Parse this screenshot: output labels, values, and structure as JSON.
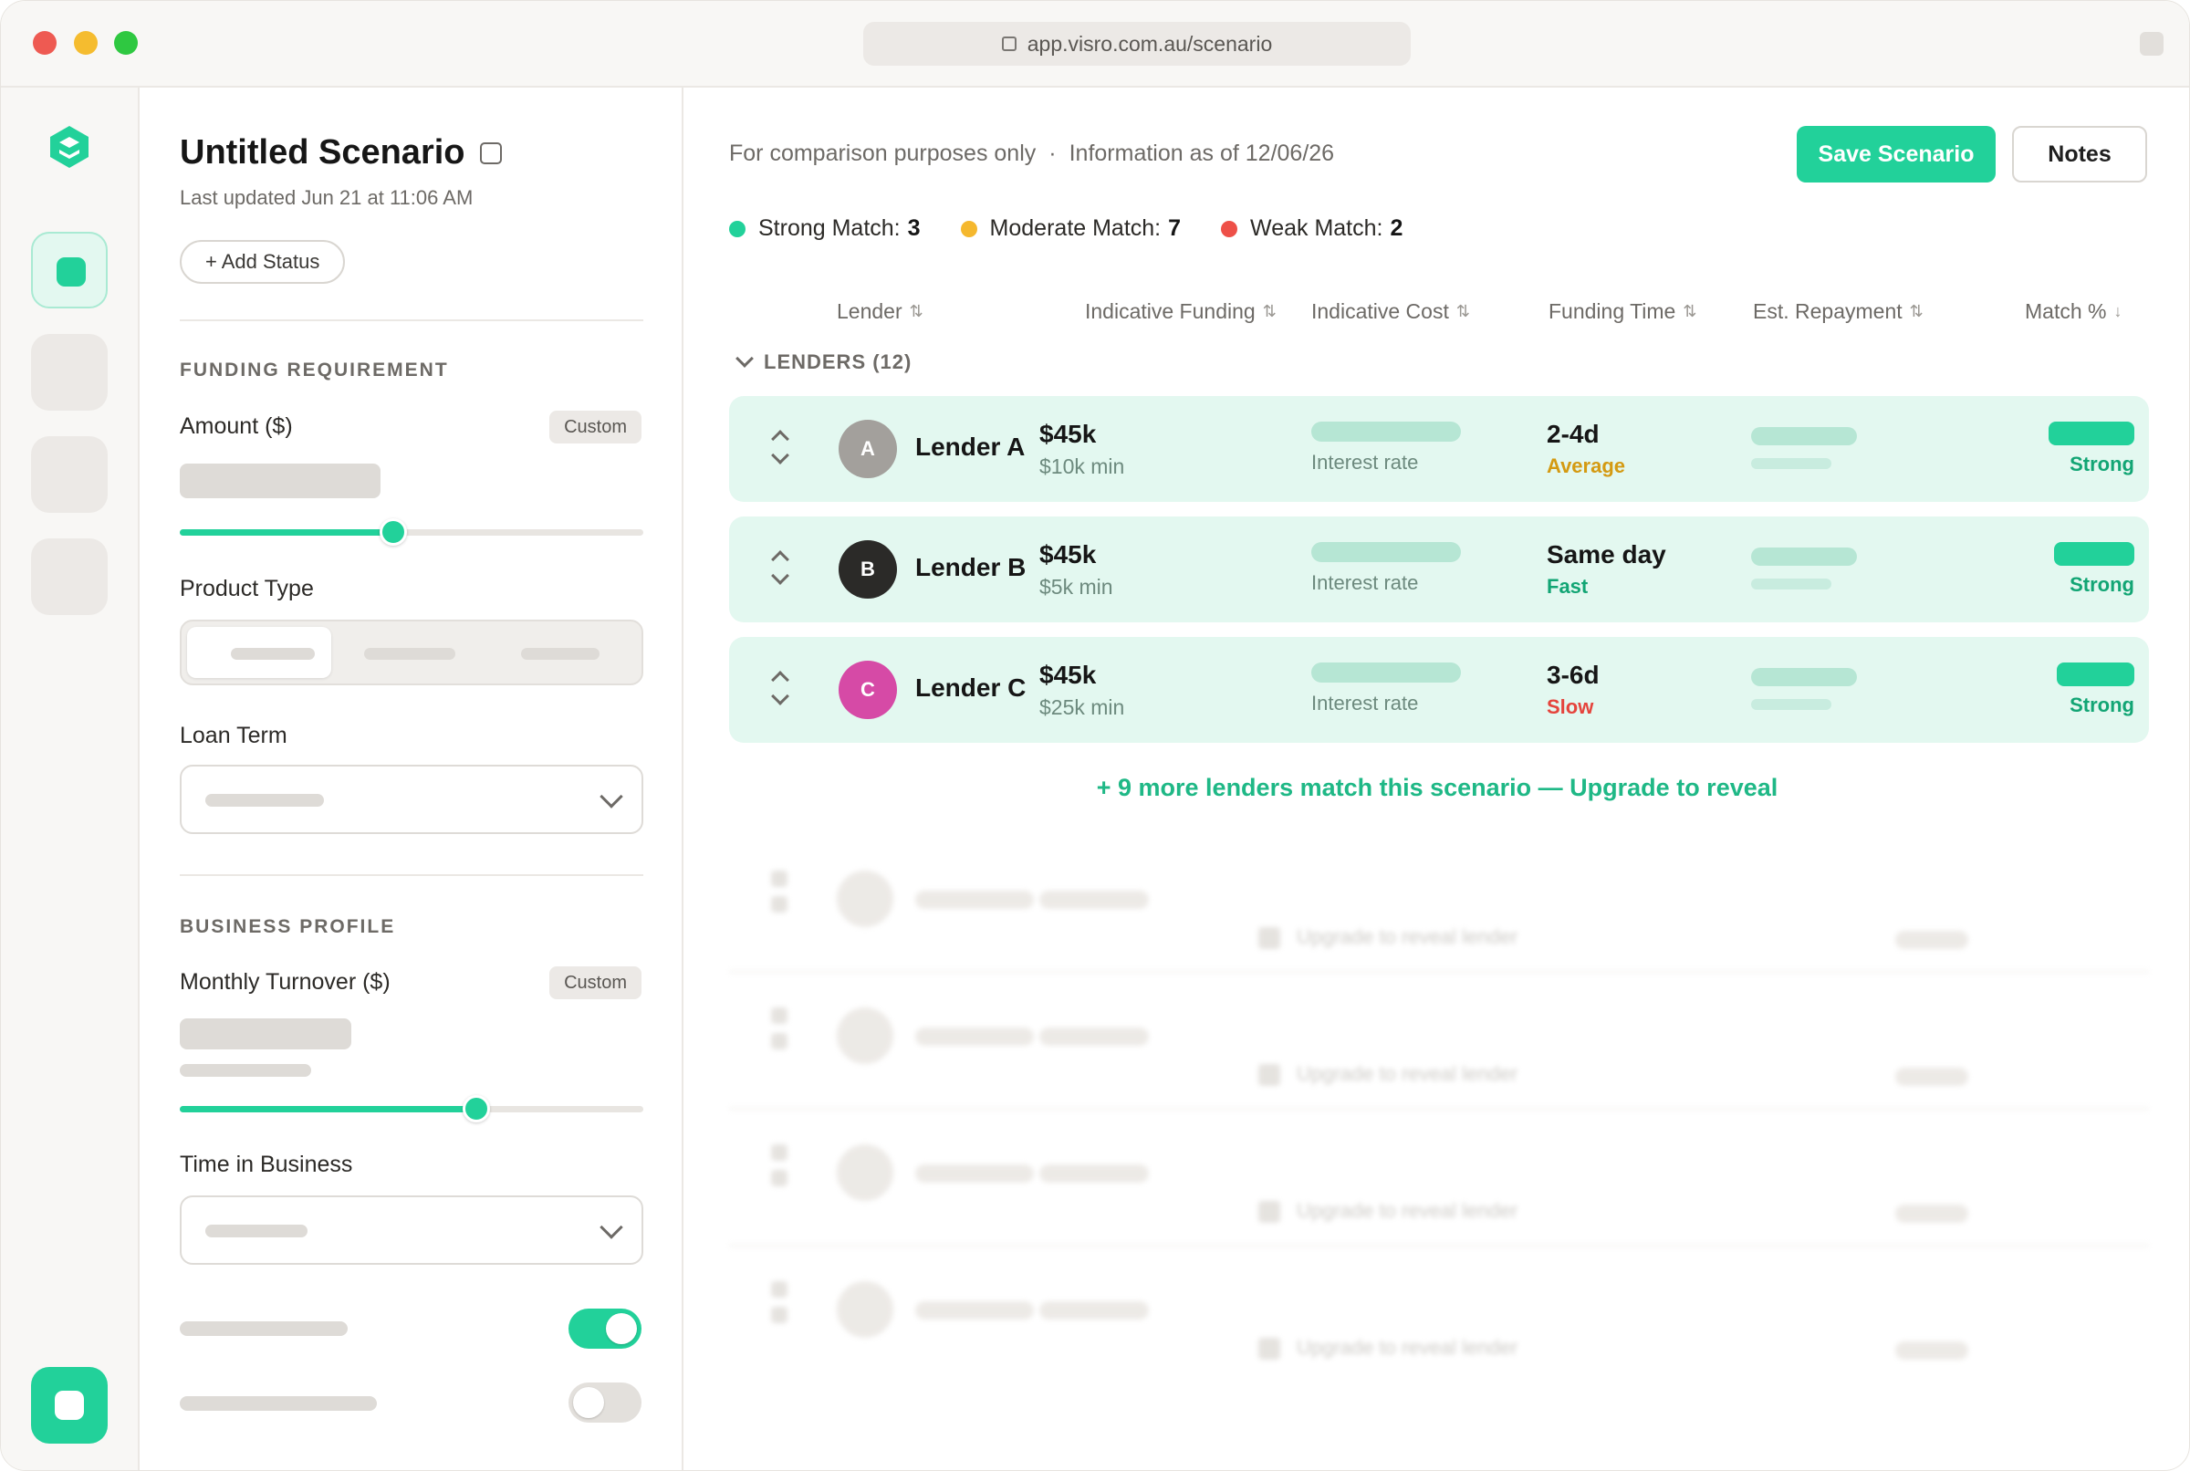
{
  "browser": {
    "url": "app.visro.com.au/scenario"
  },
  "scenario": {
    "title": "Untitled Scenario",
    "last_updated": "Last updated Jun 21 at 11:06 AM",
    "add_status_label": "+ Add Status"
  },
  "sections": {
    "funding_requirement": "FUNDING REQUIREMENT",
    "business_profile": "BUSINESS PROFILE"
  },
  "fields": {
    "amount_label": "Amount ($)",
    "custom_badge": "Custom",
    "product_type_label": "Product Type",
    "loan_term_label": "Loan Term",
    "monthly_turnover_label": "Monthly Turnover ($)",
    "time_in_business_label": "Time in Business",
    "amount_slider_level": 0.46,
    "turnover_slider_level": 0.64,
    "toggle_1_on": true,
    "toggle_2_on": false
  },
  "header": {
    "info_left": "For comparison purposes only",
    "separator": "·",
    "info_right": "Information as of 12/06/26",
    "save_label": "Save Scenario",
    "notes_label": "Notes"
  },
  "legend": {
    "strong_label": "Strong Match:",
    "strong_count": "3",
    "moderate_label": "Moderate Match:",
    "moderate_count": "7",
    "weak_label": "Weak Match:",
    "weak_count": "2",
    "colors": {
      "strong": "#22d19a",
      "moderate": "#f5b82e",
      "weak": "#ee5048"
    }
  },
  "table": {
    "columns": {
      "lender": "Lender",
      "funding": "Indicative Funding",
      "cost": "Indicative Cost",
      "time": "Funding Time",
      "repayment": "Est. Repayment",
      "match": "Match %"
    },
    "sort_icon": "⇅",
    "sort_desc_icon": "↓",
    "group_label": "LENDERS (12)",
    "rows": [
      {
        "initial": "A",
        "name": "Lender A",
        "avatar_color": "#a3a09c",
        "funding": "$45k",
        "funding_min": "$10k min",
        "cost_sub": "Interest rate",
        "time": "2-4d",
        "speed": "Average",
        "speed_color": "#d49a12",
        "match_label": "Strong",
        "match_level": 0.72
      },
      {
        "initial": "B",
        "name": "Lender B",
        "avatar_color": "#2b2a28",
        "funding": "$45k",
        "funding_min": "$5k min",
        "cost_sub": "Interest rate",
        "time": "Same day",
        "speed": "Fast",
        "speed_color": "#12a574",
        "match_label": "Strong",
        "match_level": 0.68
      },
      {
        "initial": "C",
        "name": "Lender C",
        "avatar_color": "#d64aa6",
        "funding": "$45k",
        "funding_min": "$25k min",
        "cost_sub": "Interest rate",
        "time": "3-6d",
        "speed": "Slow",
        "speed_color": "#e5443c",
        "match_label": "Strong",
        "match_level": 0.65
      }
    ],
    "upgrade_text": "+ 9 more lenders match this scenario — Upgrade to reveal",
    "locked_text": "Upgrade to reveal lender"
  }
}
